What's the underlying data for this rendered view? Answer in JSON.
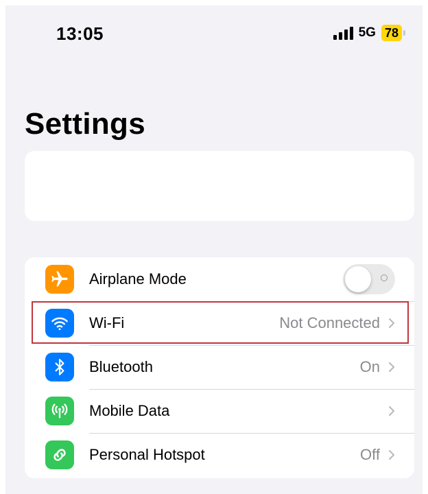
{
  "status_bar": {
    "time": "13:05",
    "network": "5G",
    "battery": "78",
    "battery_color": "#ffd60a",
    "signal_icon": "cellular-signal-icon"
  },
  "header": {
    "title": "Settings"
  },
  "rows": [
    {
      "label": "Airplane Mode",
      "icon": "airplane-icon",
      "icon_color": "#ff9500",
      "control": "toggle",
      "toggle_on": false
    },
    {
      "label": "Wi-Fi",
      "icon": "wifi-icon",
      "icon_color": "#007aff",
      "value": "Not Connected",
      "highlighted": true
    },
    {
      "label": "Bluetooth",
      "icon": "bluetooth-icon",
      "icon_color": "#007aff",
      "value": "On"
    },
    {
      "label": "Mobile Data",
      "icon": "antenna-icon",
      "icon_color": "#34c759",
      "value": ""
    },
    {
      "label": "Personal Hotspot",
      "icon": "hotspot-link-icon",
      "icon_color": "#34c759",
      "value": "Off"
    }
  ],
  "colors": {
    "highlight_border": "#c0353c",
    "background": "#f2f2f7"
  }
}
